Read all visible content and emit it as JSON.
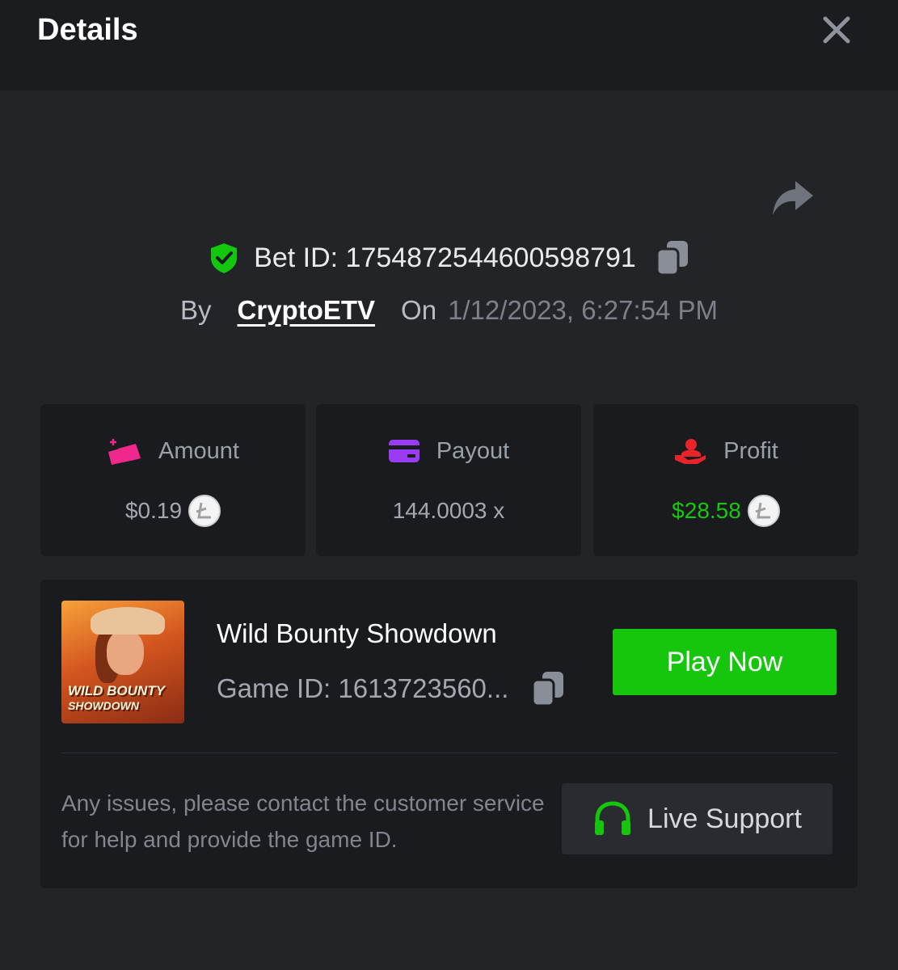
{
  "header": {
    "title": "Details"
  },
  "icons": {
    "close": "close-icon",
    "share": "share-icon",
    "copy": "copy-icon",
    "verified": "shield-check-icon"
  },
  "bet": {
    "id_label": "Bet ID: 1754872544600598791",
    "by_label": "By",
    "user": "CryptoETV",
    "on_label": "On",
    "date": "1/12/2023, 6:27:54 PM"
  },
  "stats": [
    {
      "label": "Amount",
      "value": "$0.19",
      "icon": "wallet-icon",
      "icon_color": "#f0288e"
    },
    {
      "label": "Payout",
      "value": "144.0003 x",
      "icon": "card-icon",
      "icon_color": "#9b3cf5"
    },
    {
      "label": "Profit",
      "value": "$28.58",
      "icon": "hand-money-icon",
      "icon_color": "#e8232a",
      "value_color": "#19c80e"
    }
  ],
  "game": {
    "thumb_line1": "WILD BOUNTY",
    "thumb_line2": "SHOWDOWN",
    "name": "Wild Bounty Showdown",
    "id_label": "Game ID: 1613723560...",
    "play_label": "Play Now"
  },
  "help": {
    "text": "Any issues, please contact the customer service for help and provide the game ID.",
    "support_label": "Live Support"
  },
  "colors": {
    "accent_green": "#16c60c",
    "background": "#232428",
    "panel": "#1a1b1f"
  }
}
